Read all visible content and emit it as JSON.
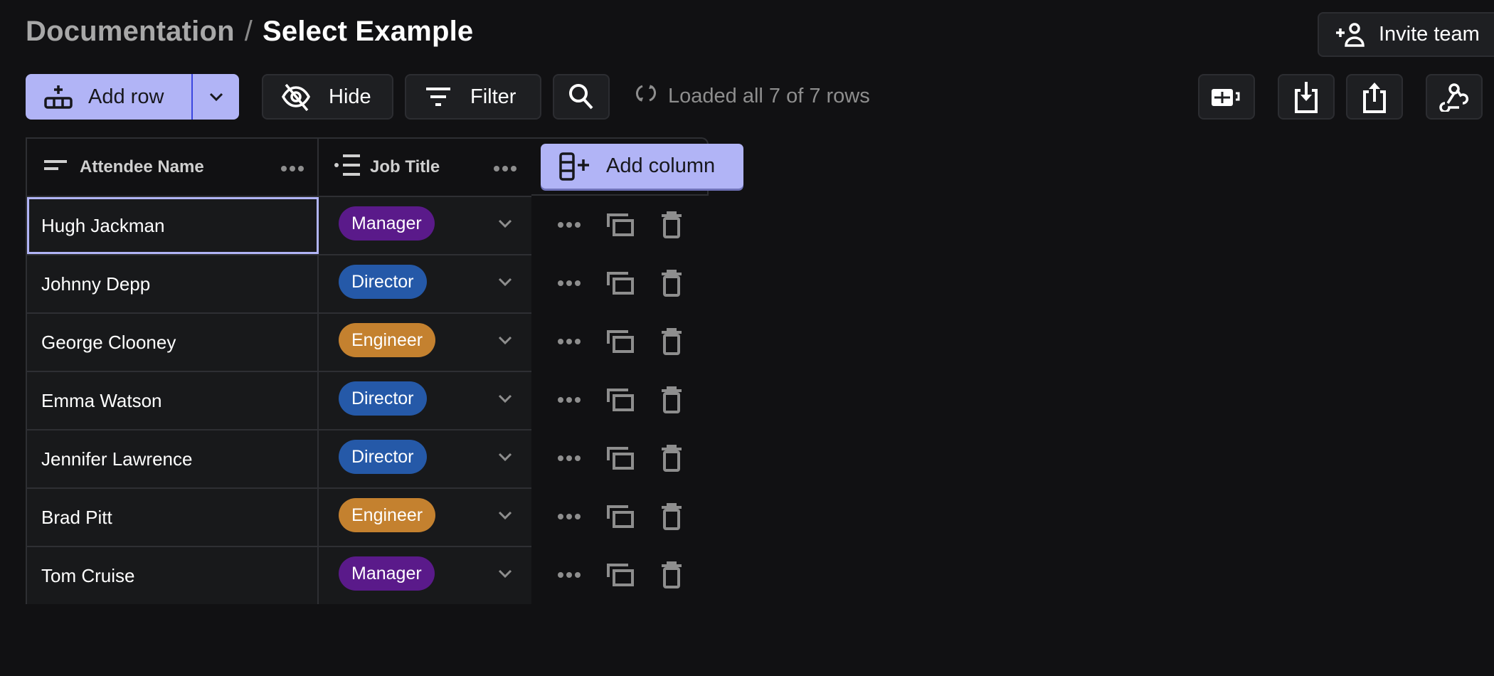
{
  "breadcrumb": {
    "parent": "Documentation",
    "separator": "/",
    "current": "Select Example"
  },
  "header": {
    "invite_label": "Invite team",
    "invite_icon": "add-person-icon"
  },
  "toolbar": {
    "add_row_label": "Add row",
    "hide_label": "Hide",
    "filter_label": "Filter",
    "status_text": "Loaded all 7 of 7 rows",
    "right_icons": [
      "table-layout-icon",
      "import-icon",
      "export-icon",
      "webhook-icon"
    ]
  },
  "table": {
    "columns": [
      {
        "label": "Attendee Name",
        "icon": "text-field-icon"
      },
      {
        "label": "Job Title",
        "icon": "select-list-icon"
      }
    ],
    "add_column_label": "Add column",
    "rows": [
      {
        "name": "Hugh Jackman",
        "job": "Manager",
        "color": "#5a1a8a"
      },
      {
        "name": "Johnny Depp",
        "job": "Director",
        "color": "#2559a8"
      },
      {
        "name": "George Clooney",
        "job": "Engineer",
        "color": "#c4812f"
      },
      {
        "name": "Emma Watson",
        "job": "Director",
        "color": "#2559a8"
      },
      {
        "name": "Jennifer Lawrence",
        "job": "Director",
        "color": "#2559a8"
      },
      {
        "name": "Brad Pitt",
        "job": "Engineer",
        "color": "#c4812f"
      },
      {
        "name": "Tom Cruise",
        "job": "Manager",
        "color": "#5a1a8a"
      }
    ],
    "selected_row": 0
  },
  "colors": {
    "accent": "#b1b4f6",
    "background": "#111113",
    "manager": "#5a1a8a",
    "director": "#2559a8",
    "engineer": "#c4812f"
  }
}
